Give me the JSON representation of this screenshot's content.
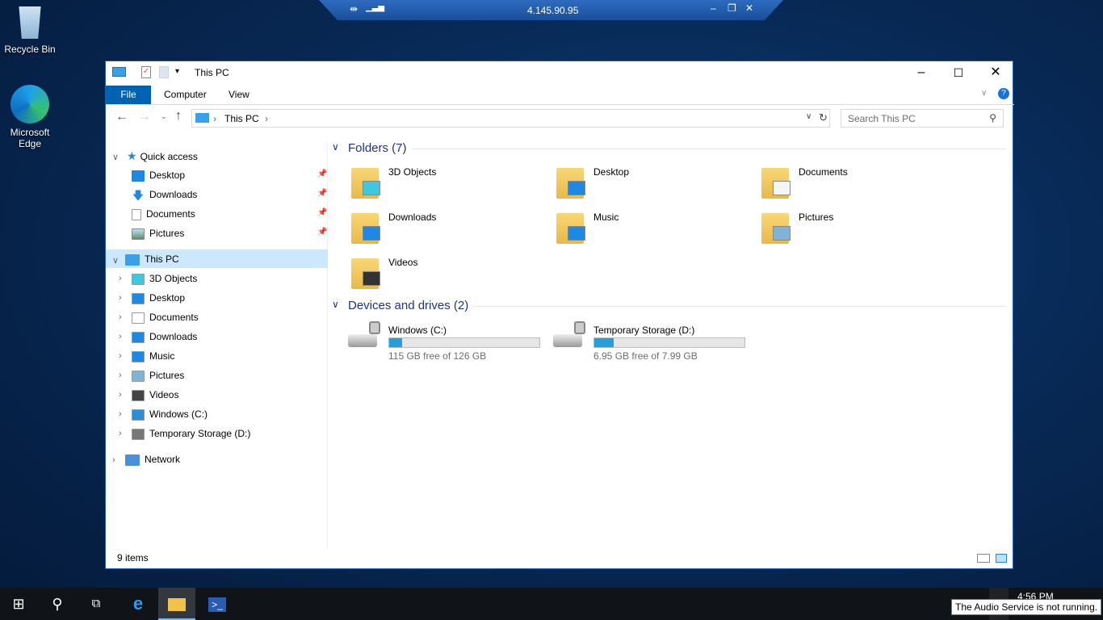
{
  "desktop": {
    "icons": [
      {
        "label": "Recycle Bin",
        "icon": "recycle-bin-icon"
      },
      {
        "label": "Microsoft Edge",
        "icon": "edge-icon"
      }
    ]
  },
  "rdp_bar": {
    "host": "4.145.90.95"
  },
  "window": {
    "title": "This PC",
    "ribbon_tabs": [
      "File",
      "Computer",
      "View"
    ],
    "address": {
      "crumb": "This PC"
    },
    "search_placeholder": "Search This PC",
    "nav": {
      "quick_access": "Quick access",
      "quick_items": [
        "Desktop",
        "Downloads",
        "Documents",
        "Pictures"
      ],
      "this_pc": "This PC",
      "pc_items": [
        "3D Objects",
        "Desktop",
        "Documents",
        "Downloads",
        "Music",
        "Pictures",
        "Videos",
        "Windows (C:)",
        "Temporary Storage (D:)"
      ],
      "network": "Network"
    },
    "folders_header": "Folders (7)",
    "folders": [
      "3D Objects",
      "Desktop",
      "Documents",
      "Downloads",
      "Music",
      "Pictures",
      "Videos"
    ],
    "devices_header": "Devices and drives (2)",
    "drives": [
      {
        "name": "Windows (C:)",
        "free": "115 GB free of 126 GB",
        "used_fraction": 0.087
      },
      {
        "name": "Temporary Storage (D:)",
        "free": "6.95 GB free of 7.99 GB",
        "used_fraction": 0.13
      }
    ],
    "status": "9 items",
    "accent": "#0063b1"
  },
  "taskbar": {
    "time": "4:56 PM",
    "tooltip": "The Audio Service is not running."
  }
}
